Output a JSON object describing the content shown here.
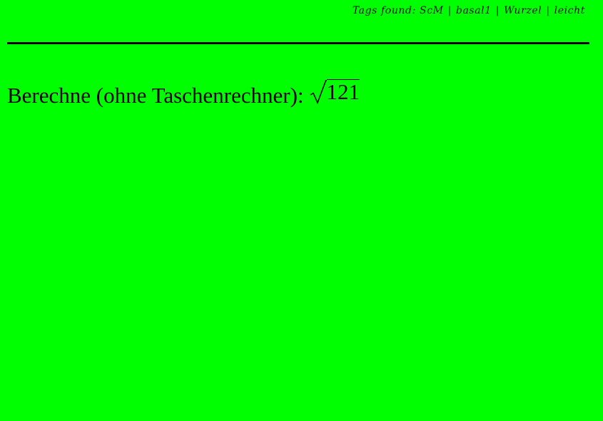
{
  "colors": {
    "background": "#00ff00",
    "text": "#000000"
  },
  "header": {
    "prefix": "Tags found:",
    "tags": [
      "ScM",
      "basal1",
      "Wurzel",
      "leicht"
    ],
    "separator": "|"
  },
  "task": {
    "text": "Berechne (ohne Taschenrechner):",
    "radicand": "121"
  }
}
